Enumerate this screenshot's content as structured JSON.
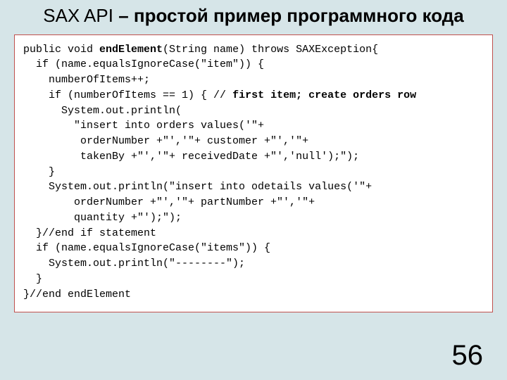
{
  "title_prefix_sax": "SAX API",
  "title_rest": " – простой пример программного кода",
  "page_number": "56",
  "code": {
    "l01a": "public void ",
    "l01b": "endElement",
    "l01c": "(String name) throws SAXException{",
    "l02": "  if (name.equalsIgnoreCase(\"item\")) {",
    "l03": "    numberOfItems++;",
    "l04a": "    if (numberOfItems == 1) { // ",
    "l04b": "first item; create orders row",
    "l05": "      System.out.println(",
    "l06": "        \"insert into orders values('\"+",
    "l07": "         orderNumber +\"','\"+ customer +\"','\"+",
    "l08": "         takenBy +\"','\"+ receivedDate +\"','null');\");",
    "l09": "    }",
    "l10": "    System.out.println(\"insert into odetails values('\"+",
    "l11": "        orderNumber +\"','\"+ partNumber +\"','\"+",
    "l12": "        quantity +\"');\");",
    "l13": "  }//end if statement",
    "l14": "  if (name.equalsIgnoreCase(\"items\")) {",
    "l15": "    System.out.println(\"--------\");",
    "l16": "  }",
    "l17": "}//end endElement"
  }
}
